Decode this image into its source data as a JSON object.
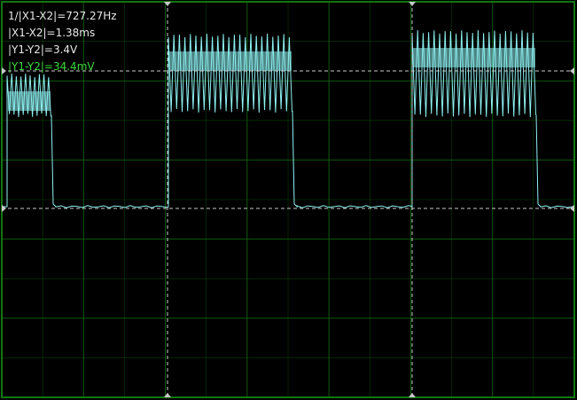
{
  "colors": {
    "background": "#000000",
    "grid": "#0c5a0c",
    "frame": "#0e780e",
    "trace": "#8ef2f2",
    "cursor": "#c8c8c8",
    "readout_text": "#e8e8e8",
    "readout_highlight": "#39d83c"
  },
  "screen": {
    "grid_divisions": {
      "horizontal": 7,
      "vertical": 5
    }
  },
  "readouts": {
    "frequency": "1/|X1-X2|=727.27Hz",
    "dx": "|X1-X2|=1.38ms",
    "dy_ch1": "|Y1-Y2|=3.4V",
    "dy_ch2": "|Y1-Y2|=34.4mV"
  }
}
